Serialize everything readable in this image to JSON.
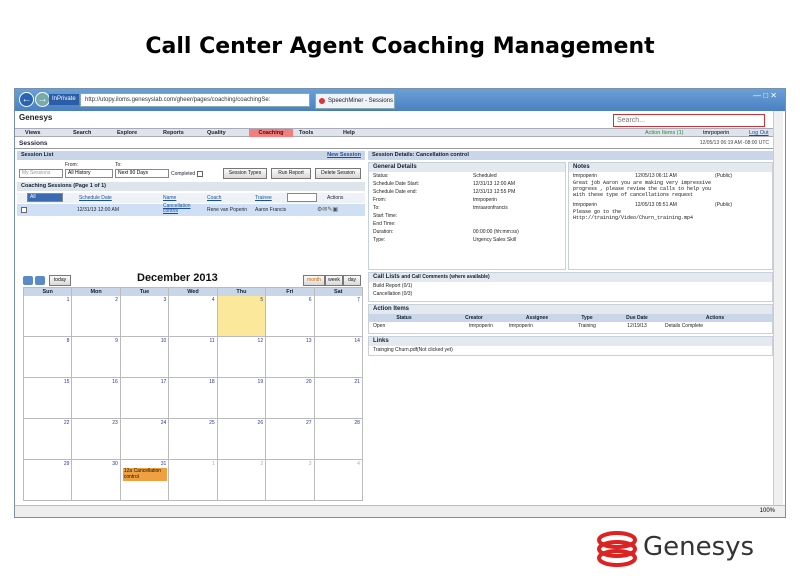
{
  "slide_title": "Call Center Agent Coaching Management",
  "browser": {
    "url": "http://utopy.iloms.genesyslab.com/gheer/pages/coaching/coachingSe:",
    "inprivate": "InPrivate",
    "tab_label": "SpeechMiner - Sessions",
    "zoom": "100%"
  },
  "app": {
    "name": "Genesys",
    "search_placeholder": "Search...",
    "action_items": "Action Items (1)",
    "user": "tmrpoperin",
    "logout": "Log Out",
    "datetime": "12/05/13 06:19 AM -08:00 UTC",
    "menu": [
      "Views",
      "Search",
      "Explore",
      "Reports",
      "Quality",
      "Coaching",
      "Tools",
      "Help"
    ],
    "active_menu": "Coaching",
    "section_title": "Sessions"
  },
  "session_list": {
    "title": "Session List",
    "new_session": "New Session",
    "from_label": "From:",
    "to_label": "To:",
    "my_sessions": "My Sessions",
    "from_value": "All History",
    "to_value": "Next 90 Days",
    "completed": "Completed",
    "btn_session_types": "Session Types",
    "btn_run_report": "Run Report",
    "btn_delete": "Delete Session",
    "page_info": "Coaching Sessions (Page 1 of 1)",
    "filter": "All",
    "columns": [
      "Schedule Date",
      "Name",
      "Coach",
      "Trainee",
      "Actions"
    ],
    "rows": [
      {
        "date": "12/31/13 12:00 AM",
        "name": "Cancellation control",
        "coach": "Rene van Poperin",
        "trainee": "Aaron Francis"
      }
    ]
  },
  "calendar": {
    "today_btn": "today",
    "title": "December 2013",
    "views": [
      "month",
      "week",
      "day"
    ],
    "days": [
      "Sun",
      "Mon",
      "Tue",
      "Wed",
      "Thu",
      "Fri",
      "Sat"
    ],
    "weeks": [
      [
        "1",
        "2",
        "3",
        "4",
        "5",
        "6",
        "7"
      ],
      [
        "8",
        "9",
        "10",
        "11",
        "12",
        "13",
        "14"
      ],
      [
        "15",
        "16",
        "17",
        "18",
        "19",
        "20",
        "21"
      ],
      [
        "22",
        "23",
        "24",
        "25",
        "26",
        "27",
        "28"
      ],
      [
        "29",
        "30",
        "31",
        "1",
        "2",
        "3",
        "4"
      ]
    ],
    "event": "12a Cancellation control"
  },
  "details": {
    "title": "Session Details: Cancellation control",
    "general_title": "General Details",
    "notes_title": "Notes",
    "fields": [
      {
        "k": "Status:",
        "v": "Scheduled"
      },
      {
        "k": "Schedule Date Start:",
        "v": "12/31/13 12:00 AM"
      },
      {
        "k": "Schedule Date end:",
        "v": "12/31/13 12:55 PM"
      },
      {
        "k": "From:",
        "v": "tmrpoperin"
      },
      {
        "k": "To:",
        "v": "tmraaronfrancis"
      },
      {
        "k": "Start Time:",
        "v": ""
      },
      {
        "k": "End Time:",
        "v": ""
      },
      {
        "k": "Duration:",
        "v": "00:00:00 (hh:mm:ss)"
      },
      {
        "k": "Type:",
        "v": "Urgency Sales Skill"
      }
    ],
    "notes": [
      {
        "author": "tmrpoperin",
        "date": "12/05/13 06:11 AM",
        "vis": "(Public)",
        "text": "Great job Aaron you are making very impressive\nprogress , please review the calls to help you\nwith these type of cancellations request"
      },
      {
        "author": "tmrpoperin",
        "date": "12/05/13 05:51 AM",
        "vis": "(Public)",
        "text": "Please go to the\nHttp://training/Video/Churn_training.mp4"
      }
    ],
    "call_lists_title": "Call Lists",
    "call_lists_sub": "and Call Comments (where available)",
    "call_lists": [
      "Build Report (0/1)",
      "Cancellation (0/3)"
    ],
    "action_items_title": "Action Items",
    "ai_columns": [
      "Status",
      "Creator",
      "Assignee",
      "Type",
      "Due Date",
      "Actions"
    ],
    "ai_rows": [
      {
        "status": "Open",
        "creator": "tmrpoperin",
        "assignee": "tmrpoperin",
        "type": "Training",
        "due": "12/19/13",
        "actions": "Details  Complete"
      }
    ],
    "links_title": "Links",
    "links": [
      "Trainging Churn.pdf(Not clicked yet)"
    ]
  },
  "brand": "Genesys"
}
